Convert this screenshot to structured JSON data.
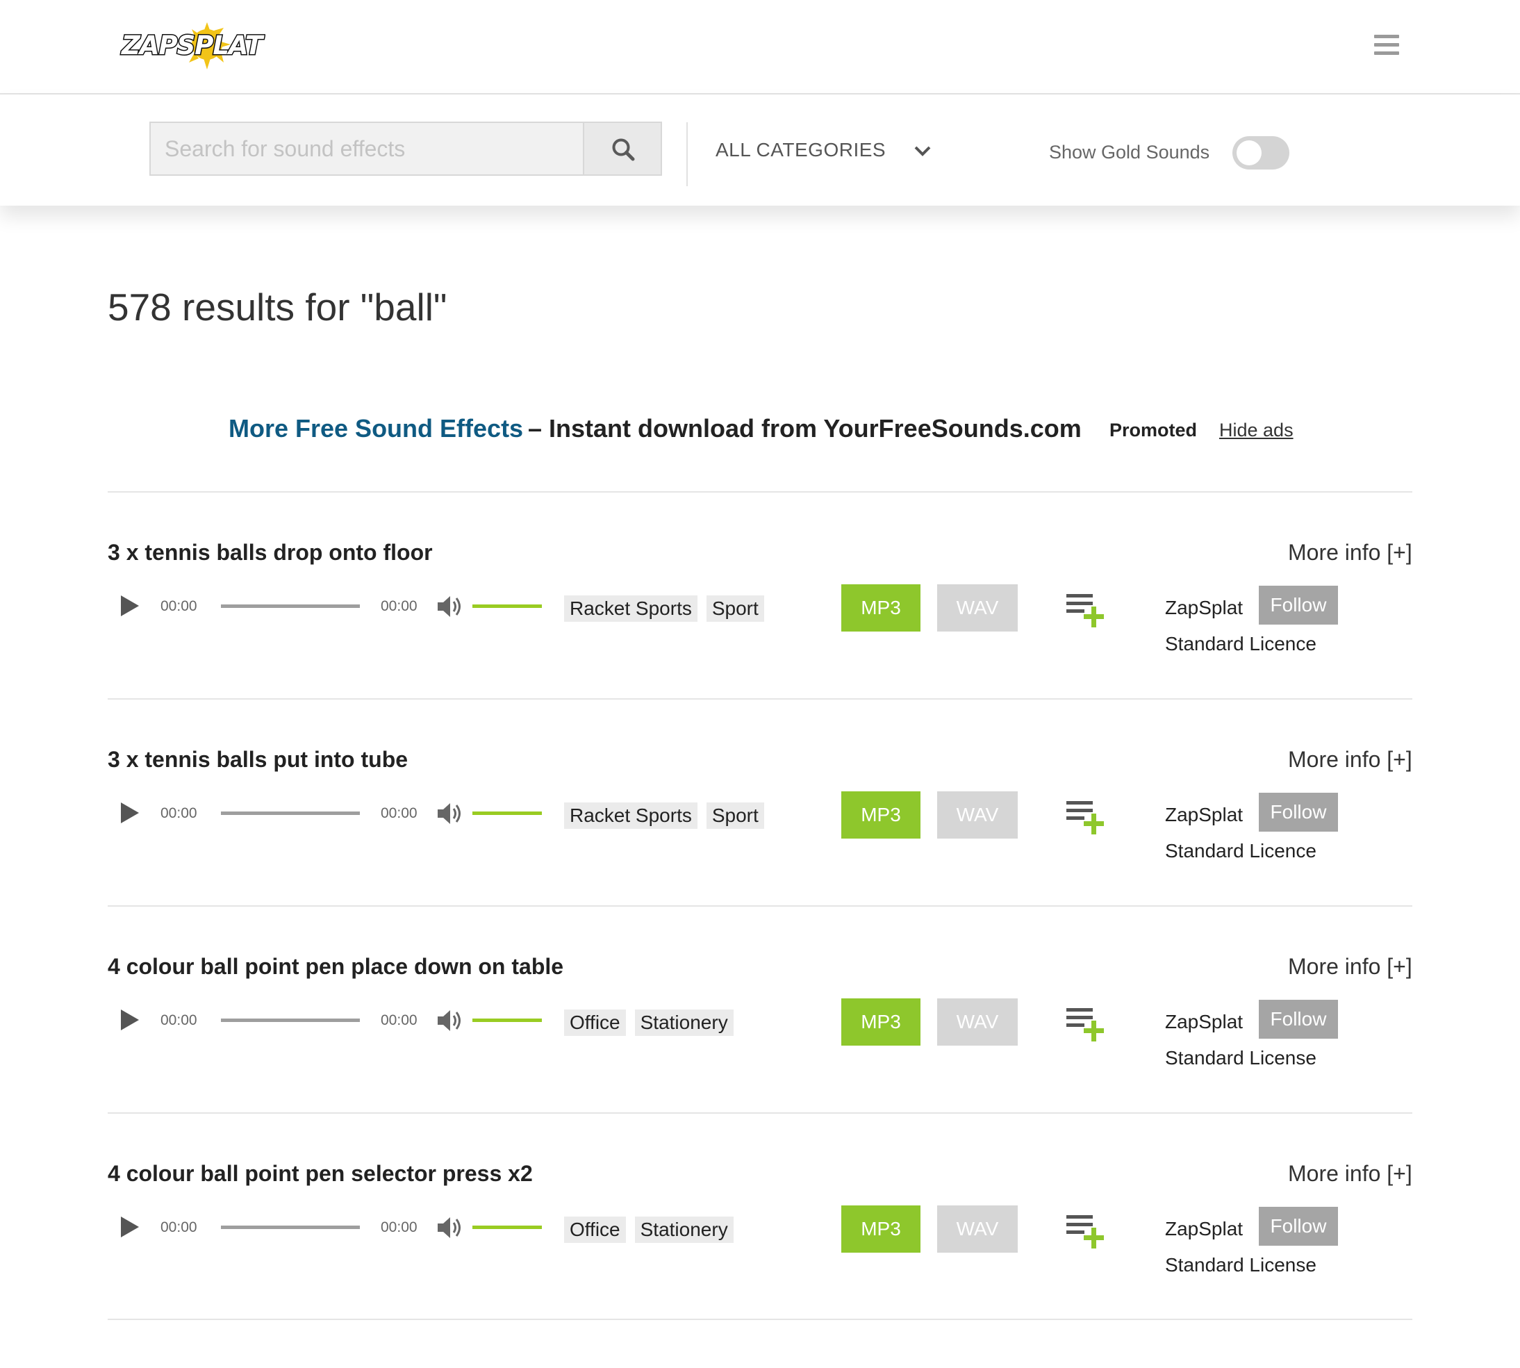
{
  "header": {
    "logo_text": "ZAPSPLAT",
    "menu_icon": "hamburger-menu-icon"
  },
  "search": {
    "placeholder": "Search for sound effects",
    "value": "",
    "button_icon": "search-icon",
    "category": "ALL CATEGORIES",
    "category_icon": "chevron-down-icon",
    "gold_label": "Show Gold Sounds",
    "gold_enabled": false
  },
  "results": {
    "heading": "578 results for \"ball\""
  },
  "promo": {
    "link_text": "More Free Sound Effects",
    "rest_text": "– Instant download from YourFreeSounds.com",
    "tag": "Promoted",
    "hide_ads": "Hide ads"
  },
  "colors": {
    "brand_green": "#8ec72c",
    "promo_blue": "#0f5a82",
    "wav_gray": "#d6d6d6",
    "follow_gray": "#a5a5a5"
  },
  "items": [
    {
      "title": "3 x tennis balls drop onto floor",
      "more_info": "More info [+]",
      "time_start": "00:00",
      "time_end": "00:00",
      "tags": [
        "Racket Sports",
        "Sport"
      ],
      "mp3": "MP3",
      "wav": "WAV",
      "author": "ZapSplat",
      "follow": "Follow",
      "licence": "Standard Licence"
    },
    {
      "title": "3 x tennis balls put into tube",
      "more_info": "More info [+]",
      "time_start": "00:00",
      "time_end": "00:00",
      "tags": [
        "Racket Sports",
        "Sport"
      ],
      "mp3": "MP3",
      "wav": "WAV",
      "author": "ZapSplat",
      "follow": "Follow",
      "licence": "Standard Licence"
    },
    {
      "title": "4 colour ball point pen place down on table",
      "more_info": "More info [+]",
      "time_start": "00:00",
      "time_end": "00:00",
      "tags": [
        "Office",
        "Stationery"
      ],
      "mp3": "MP3",
      "wav": "WAV",
      "author": "ZapSplat",
      "follow": "Follow",
      "licence": "Standard License"
    },
    {
      "title": "4 colour ball point pen selector press x2",
      "more_info": "More info [+]",
      "time_start": "00:00",
      "time_end": "00:00",
      "tags": [
        "Office",
        "Stationery"
      ],
      "mp3": "MP3",
      "wav": "WAV",
      "author": "ZapSplat",
      "follow": "Follow",
      "licence": "Standard License"
    }
  ]
}
